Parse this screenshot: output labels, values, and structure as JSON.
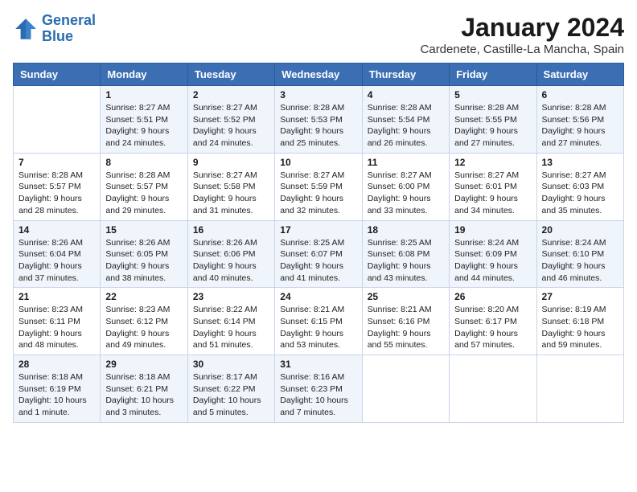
{
  "logo": {
    "line1": "General",
    "line2": "Blue"
  },
  "title": "January 2024",
  "location": "Cardenete, Castille-La Mancha, Spain",
  "days_of_week": [
    "Sunday",
    "Monday",
    "Tuesday",
    "Wednesday",
    "Thursday",
    "Friday",
    "Saturday"
  ],
  "weeks": [
    [
      {
        "num": "",
        "sunrise": "",
        "sunset": "",
        "daylight": ""
      },
      {
        "num": "1",
        "sunrise": "Sunrise: 8:27 AM",
        "sunset": "Sunset: 5:51 PM",
        "daylight": "Daylight: 9 hours and 24 minutes."
      },
      {
        "num": "2",
        "sunrise": "Sunrise: 8:27 AM",
        "sunset": "Sunset: 5:52 PM",
        "daylight": "Daylight: 9 hours and 24 minutes."
      },
      {
        "num": "3",
        "sunrise": "Sunrise: 8:28 AM",
        "sunset": "Sunset: 5:53 PM",
        "daylight": "Daylight: 9 hours and 25 minutes."
      },
      {
        "num": "4",
        "sunrise": "Sunrise: 8:28 AM",
        "sunset": "Sunset: 5:54 PM",
        "daylight": "Daylight: 9 hours and 26 minutes."
      },
      {
        "num": "5",
        "sunrise": "Sunrise: 8:28 AM",
        "sunset": "Sunset: 5:55 PM",
        "daylight": "Daylight: 9 hours and 27 minutes."
      },
      {
        "num": "6",
        "sunrise": "Sunrise: 8:28 AM",
        "sunset": "Sunset: 5:56 PM",
        "daylight": "Daylight: 9 hours and 27 minutes."
      }
    ],
    [
      {
        "num": "7",
        "sunrise": "Sunrise: 8:28 AM",
        "sunset": "Sunset: 5:57 PM",
        "daylight": "Daylight: 9 hours and 28 minutes."
      },
      {
        "num": "8",
        "sunrise": "Sunrise: 8:28 AM",
        "sunset": "Sunset: 5:57 PM",
        "daylight": "Daylight: 9 hours and 29 minutes."
      },
      {
        "num": "9",
        "sunrise": "Sunrise: 8:27 AM",
        "sunset": "Sunset: 5:58 PM",
        "daylight": "Daylight: 9 hours and 31 minutes."
      },
      {
        "num": "10",
        "sunrise": "Sunrise: 8:27 AM",
        "sunset": "Sunset: 5:59 PM",
        "daylight": "Daylight: 9 hours and 32 minutes."
      },
      {
        "num": "11",
        "sunrise": "Sunrise: 8:27 AM",
        "sunset": "Sunset: 6:00 PM",
        "daylight": "Daylight: 9 hours and 33 minutes."
      },
      {
        "num": "12",
        "sunrise": "Sunrise: 8:27 AM",
        "sunset": "Sunset: 6:01 PM",
        "daylight": "Daylight: 9 hours and 34 minutes."
      },
      {
        "num": "13",
        "sunrise": "Sunrise: 8:27 AM",
        "sunset": "Sunset: 6:03 PM",
        "daylight": "Daylight: 9 hours and 35 minutes."
      }
    ],
    [
      {
        "num": "14",
        "sunrise": "Sunrise: 8:26 AM",
        "sunset": "Sunset: 6:04 PM",
        "daylight": "Daylight: 9 hours and 37 minutes."
      },
      {
        "num": "15",
        "sunrise": "Sunrise: 8:26 AM",
        "sunset": "Sunset: 6:05 PM",
        "daylight": "Daylight: 9 hours and 38 minutes."
      },
      {
        "num": "16",
        "sunrise": "Sunrise: 8:26 AM",
        "sunset": "Sunset: 6:06 PM",
        "daylight": "Daylight: 9 hours and 40 minutes."
      },
      {
        "num": "17",
        "sunrise": "Sunrise: 8:25 AM",
        "sunset": "Sunset: 6:07 PM",
        "daylight": "Daylight: 9 hours and 41 minutes."
      },
      {
        "num": "18",
        "sunrise": "Sunrise: 8:25 AM",
        "sunset": "Sunset: 6:08 PM",
        "daylight": "Daylight: 9 hours and 43 minutes."
      },
      {
        "num": "19",
        "sunrise": "Sunrise: 8:24 AM",
        "sunset": "Sunset: 6:09 PM",
        "daylight": "Daylight: 9 hours and 44 minutes."
      },
      {
        "num": "20",
        "sunrise": "Sunrise: 8:24 AM",
        "sunset": "Sunset: 6:10 PM",
        "daylight": "Daylight: 9 hours and 46 minutes."
      }
    ],
    [
      {
        "num": "21",
        "sunrise": "Sunrise: 8:23 AM",
        "sunset": "Sunset: 6:11 PM",
        "daylight": "Daylight: 9 hours and 48 minutes."
      },
      {
        "num": "22",
        "sunrise": "Sunrise: 8:23 AM",
        "sunset": "Sunset: 6:12 PM",
        "daylight": "Daylight: 9 hours and 49 minutes."
      },
      {
        "num": "23",
        "sunrise": "Sunrise: 8:22 AM",
        "sunset": "Sunset: 6:14 PM",
        "daylight": "Daylight: 9 hours and 51 minutes."
      },
      {
        "num": "24",
        "sunrise": "Sunrise: 8:21 AM",
        "sunset": "Sunset: 6:15 PM",
        "daylight": "Daylight: 9 hours and 53 minutes."
      },
      {
        "num": "25",
        "sunrise": "Sunrise: 8:21 AM",
        "sunset": "Sunset: 6:16 PM",
        "daylight": "Daylight: 9 hours and 55 minutes."
      },
      {
        "num": "26",
        "sunrise": "Sunrise: 8:20 AM",
        "sunset": "Sunset: 6:17 PM",
        "daylight": "Daylight: 9 hours and 57 minutes."
      },
      {
        "num": "27",
        "sunrise": "Sunrise: 8:19 AM",
        "sunset": "Sunset: 6:18 PM",
        "daylight": "Daylight: 9 hours and 59 minutes."
      }
    ],
    [
      {
        "num": "28",
        "sunrise": "Sunrise: 8:18 AM",
        "sunset": "Sunset: 6:19 PM",
        "daylight": "Daylight: 10 hours and 1 minute."
      },
      {
        "num": "29",
        "sunrise": "Sunrise: 8:18 AM",
        "sunset": "Sunset: 6:21 PM",
        "daylight": "Daylight: 10 hours and 3 minutes."
      },
      {
        "num": "30",
        "sunrise": "Sunrise: 8:17 AM",
        "sunset": "Sunset: 6:22 PM",
        "daylight": "Daylight: 10 hours and 5 minutes."
      },
      {
        "num": "31",
        "sunrise": "Sunrise: 8:16 AM",
        "sunset": "Sunset: 6:23 PM",
        "daylight": "Daylight: 10 hours and 7 minutes."
      },
      {
        "num": "",
        "sunrise": "",
        "sunset": "",
        "daylight": ""
      },
      {
        "num": "",
        "sunrise": "",
        "sunset": "",
        "daylight": ""
      },
      {
        "num": "",
        "sunrise": "",
        "sunset": "",
        "daylight": ""
      }
    ]
  ]
}
